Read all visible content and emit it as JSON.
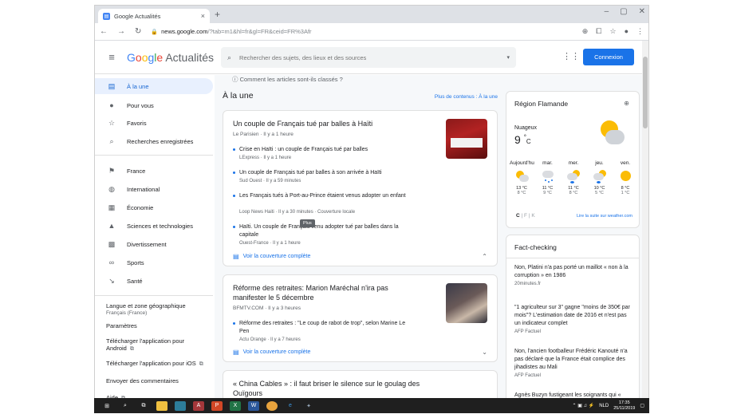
{
  "browser": {
    "tab_title": "Google Actualités",
    "tab_close": "×",
    "new_tab": "+",
    "url_host": "news.google.com",
    "url_path": "/?tab=m1&hl=fr&gl=FR&ceid=FR%3Afr",
    "window_minimize": "–",
    "window_maximize": "▢",
    "window_close": "✕"
  },
  "header": {
    "brand_g": [
      "G",
      "o",
      "o",
      "g",
      "l",
      "e"
    ],
    "brand_rest": " Actualités",
    "search_placeholder": "Rechercher des sujets, des lieux et des sources",
    "login_label": "Connexion"
  },
  "sidebar": {
    "items": [
      {
        "label": "À la une",
        "icon": "newspaper-icon",
        "glyph": "▤"
      },
      {
        "label": "Pour vous",
        "icon": "person-icon",
        "glyph": "●"
      },
      {
        "label": "Favoris",
        "icon": "star-icon",
        "glyph": "☆"
      },
      {
        "label": "Recherches enregistrées",
        "icon": "search-icon",
        "glyph": "⌕"
      },
      {
        "label": "France",
        "icon": "flag-icon",
        "glyph": "⚑"
      },
      {
        "label": "International",
        "icon": "globe-icon",
        "glyph": "◍"
      },
      {
        "label": "Économie",
        "icon": "building-icon",
        "glyph": "▦"
      },
      {
        "label": "Sciences et technologies",
        "icon": "flask-icon",
        "glyph": "▲"
      },
      {
        "label": "Divertissement",
        "icon": "film-icon",
        "glyph": "▩"
      },
      {
        "label": "Sports",
        "icon": "bike-icon",
        "glyph": "∞"
      },
      {
        "label": "Santé",
        "icon": "health-icon",
        "glyph": "↘"
      }
    ],
    "language_label": "Langue et zone géographique",
    "language_value": "Français (France)",
    "settings": "Paramètres",
    "android": "Télécharger l'application pour Android",
    "ios": "Télécharger l'application pour iOS",
    "feedback": "Envoyer des commentaires",
    "help": "Aide",
    "ext_glyph": "⧉"
  },
  "main": {
    "how_sorted": "ⓘ Comment les articles sont-ils classés ?",
    "section_title": "À la une",
    "section_more": "Plus de contenus : À la une",
    "tooltip": "Plus",
    "full_coverage": "Voir la couverture complète",
    "stories": [
      {
        "title": "Un couple de Français tué par balles à Haïti",
        "meta": "Le Parisien · Il y a 1 heure",
        "subs": [
          {
            "title": "Crise en Haïti : un couple de Français tué par balles",
            "meta": "LExpress · Il y a 1 heure"
          },
          {
            "title": "Un couple de Français tué par balles à son arrivée à Haïti",
            "meta": "Sud Ouest · Il y a 59 minutes"
          },
          {
            "title": "Les Français tués à Port-au-Prince étaient venus adopter un enfant",
            "meta": "Loop News Haiti · Il y a 30 minutes · Couverture locale"
          },
          {
            "title": "Haïti. Un couple de Français venu adopter tué par balles dans la capitale",
            "meta": "Ouest-France · Il y a 1 heure"
          }
        ]
      },
      {
        "title": "Réforme des retraites: Marion Maréchal n'ira pas manifester le 5 décembre",
        "meta": "BFMTV.COM · Il y a 3 heures",
        "subs": [
          {
            "title": "Réforme des retraites : \"Le coup de rabot de trop\", selon Marine Le Pen",
            "meta": "Actu Orange · Il y a 7 heures"
          }
        ]
      },
      {
        "title": "« China Cables » : il faut briser le silence sur le goulag des Ouïgours",
        "meta": ""
      }
    ]
  },
  "weather": {
    "title": "Région Flamande",
    "condition": "Nuageux",
    "temp": "9",
    "unit": "°",
    "unit_letter": "C",
    "days": [
      {
        "label": "Aujourd'hu",
        "hi": "13 °C",
        "lo": "8 °C",
        "icon": "partly-cloudy-icon"
      },
      {
        "label": "mar.",
        "hi": "11 °C",
        "lo": "9 °C",
        "icon": "rain-icon"
      },
      {
        "label": "mer.",
        "hi": "11 °C",
        "lo": "8 °C",
        "icon": "rain-sun-icon"
      },
      {
        "label": "jeu.",
        "hi": "10 °C",
        "lo": "5 °C",
        "icon": "rain-sun-icon"
      },
      {
        "label": "ven.",
        "hi": "8 °C",
        "lo": "1 °C",
        "icon": "sun-icon"
      }
    ],
    "unit_c": "C",
    "unit_f": "F",
    "unit_k": "K",
    "more_link": "Lire la suite sur weather.com"
  },
  "factcheck": {
    "title": "Fact-checking",
    "items": [
      {
        "title": "Non, Platini n'a pas porté un maillot « non à la corruption » en 1986",
        "source": "20minutes.fr"
      },
      {
        "title": "\"1 agriculteur sur 3\" gagne \"moins de 350€ par mois\"? L'estimation date de 2016 et n'est pas un indicateur complet",
        "source": "AFP Factuel"
      },
      {
        "title": "Non, l'ancien footballeur Frédéric Kanouté n'a pas déclaré que la France était complice des jihadistes au Mali",
        "source": "AFP Factuel"
      },
      {
        "title": "Agnès Buzyn fustigeant les soignants qui « gaspillent » du matériel ? La",
        "source": ""
      }
    ]
  },
  "taskbar": {
    "time": "17:35",
    "date": "25/11/2019",
    "lang": "NLD"
  },
  "colors": {
    "accent": "#1a73e8",
    "active_bg": "#e8f0fe"
  }
}
